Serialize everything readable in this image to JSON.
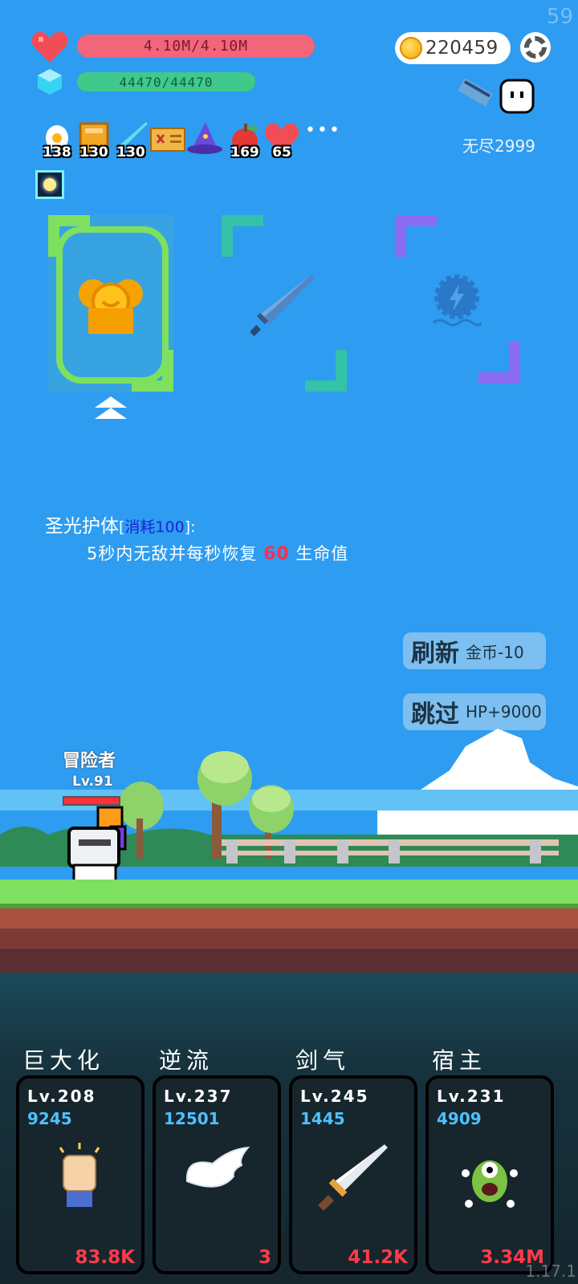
{
  "fps": "59",
  "version": "1.17.1",
  "hp": {
    "text": "4.10M/4.10M",
    "fill": 1.0,
    "color": "#f3657a"
  },
  "mp": {
    "text": "44470/44470",
    "fill": 1.0,
    "color": "#3fc98b"
  },
  "coins": "220459",
  "endless": "无尽2999",
  "inventory": [
    {
      "icon": "egg-icon",
      "count": "138"
    },
    {
      "icon": "book-icon",
      "count": "130"
    },
    {
      "icon": "sword-icon",
      "count": "130"
    },
    {
      "icon": "map-icon",
      "count": ""
    },
    {
      "icon": "wizard-hat-icon",
      "count": ""
    },
    {
      "icon": "apple-icon",
      "count": "169"
    },
    {
      "icon": "heart-icon",
      "count": "65"
    }
  ],
  "more": "•••",
  "skill_desc": {
    "name": "圣光护体",
    "cost_open": "[",
    "cost": "消耗100",
    "cost_close": "]:",
    "line_pre": "5秒内无敌并每秒恢复",
    "value": "60",
    "line_post": "生命值"
  },
  "refresh": {
    "label": "刷新",
    "cost": "金币-10"
  },
  "skip": {
    "label": "跳过",
    "reward": "HP+9000"
  },
  "player": {
    "title": "冒险者",
    "level": "Lv.91"
  },
  "skills": [
    {
      "name": "巨大化",
      "level": "Lv.208",
      "num": "9245",
      "value": "83.8K",
      "icon": "fist-icon"
    },
    {
      "name": "逆流",
      "level": "Lv.237",
      "num": "12501",
      "value": "3",
      "icon": "wing-icon"
    },
    {
      "name": "剑气",
      "level": "Lv.245",
      "num": "1445",
      "value": "41.2K",
      "icon": "sword-icon"
    },
    {
      "name": "宿主",
      "level": "Lv.231",
      "num": "4909",
      "value": "3.34M",
      "icon": "monster-icon"
    }
  ]
}
